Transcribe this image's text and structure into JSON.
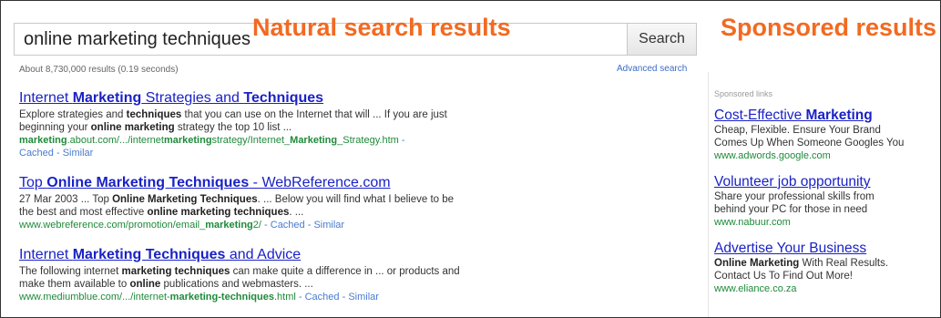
{
  "search": {
    "query": "online marketing techniques",
    "button_label": "Search",
    "stats": "About 8,730,000 results (0.19 seconds)",
    "advanced_label": "Advanced search"
  },
  "overlays": {
    "natural": "Natural search results",
    "sponsored": "Sponsored results"
  },
  "results": [
    {
      "title": [
        {
          "t": "Internet "
        },
        {
          "t": "Marketing",
          "b": true
        },
        {
          "t": " Strategies and "
        },
        {
          "t": "Techniques",
          "b": true
        }
      ],
      "snippet_lines": [
        [
          {
            "t": "Explore strategies and "
          },
          {
            "t": "techniques",
            "b": true
          },
          {
            "t": " that you can use on the Internet that will ... If you are just"
          }
        ],
        [
          {
            "t": "beginning your "
          },
          {
            "t": "online marketing",
            "b": true
          },
          {
            "t": " strategy the top 10 list ..."
          }
        ]
      ],
      "url": [
        {
          "t": "marketing",
          "b": true
        },
        {
          "t": ".about.com/.../internet"
        },
        {
          "t": "marketing",
          "b": true
        },
        {
          "t": "strategy/Internet_"
        },
        {
          "t": "Marketing",
          "b": true
        },
        {
          "t": "_Strategy.htm"
        }
      ],
      "url_meta_inline": " - ",
      "meta_line": "Cached - Similar"
    },
    {
      "title": [
        {
          "t": "Top "
        },
        {
          "t": "Online Marketing Techniques",
          "b": true
        },
        {
          "t": " - WebReference.com"
        }
      ],
      "snippet_lines": [
        [
          {
            "t": "27 Mar 2003 ... Top "
          },
          {
            "t": "Online Marketing Techniques",
            "b": true
          },
          {
            "t": ". ... Below you will find what I believe to be"
          }
        ],
        [
          {
            "t": "the best and most effective "
          },
          {
            "t": "online marketing techniques",
            "b": true
          },
          {
            "t": ". ..."
          }
        ]
      ],
      "url": [
        {
          "t": "www.webreference.com/promotion/email_"
        },
        {
          "t": "marketing",
          "b": true
        },
        {
          "t": "2/"
        }
      ],
      "url_meta_inline": " - Cached - Similar",
      "meta_line": ""
    },
    {
      "title": [
        {
          "t": "Internet "
        },
        {
          "t": "Marketing Techniques",
          "b": true
        },
        {
          "t": " and Advice"
        }
      ],
      "snippet_lines": [
        [
          {
            "t": "The following internet "
          },
          {
            "t": "marketing techniques",
            "b": true
          },
          {
            "t": " can make quite a difference in ... or products and"
          }
        ],
        [
          {
            "t": "make them available to "
          },
          {
            "t": "online",
            "b": true
          },
          {
            "t": " publications and webmasters. ..."
          }
        ]
      ],
      "url": [
        {
          "t": "www.mediumblue.com/.../internet-"
        },
        {
          "t": "marketing-techniques",
          "b": true
        },
        {
          "t": ".html"
        }
      ],
      "url_meta_inline": " - Cached - Similar",
      "meta_line": ""
    }
  ],
  "sponsored": {
    "header": "Sponsored links",
    "ads": [
      {
        "title": [
          {
            "t": "Cost-Effective "
          },
          {
            "t": "Marketing",
            "b": true
          }
        ],
        "lines": [
          [
            {
              "t": "Cheap, Flexible. Ensure Your Brand"
            }
          ],
          [
            {
              "t": "Comes Up When Someone Googles You"
            }
          ]
        ],
        "url": "www.adwords.google.com"
      },
      {
        "title": [
          {
            "t": "Volunteer job opportunity"
          }
        ],
        "lines": [
          [
            {
              "t": "Share your professional skills from"
            }
          ],
          [
            {
              "t": "behind your PC for those in need"
            }
          ]
        ],
        "url": "www.nabuur.com"
      },
      {
        "title": [
          {
            "t": "Advertise Your Business"
          }
        ],
        "lines": [
          [
            {
              "t": "Online Marketing",
              "b": true
            },
            {
              "t": " With Real Results."
            }
          ],
          [
            {
              "t": "Contact Us To Find Out More!"
            }
          ]
        ],
        "url": "www.eliance.co.za"
      }
    ]
  },
  "colors": {
    "overlay": "#f26a21",
    "link": "#1a22c6",
    "url": "#1e8a3a",
    "meta": "#4a7bd0"
  }
}
